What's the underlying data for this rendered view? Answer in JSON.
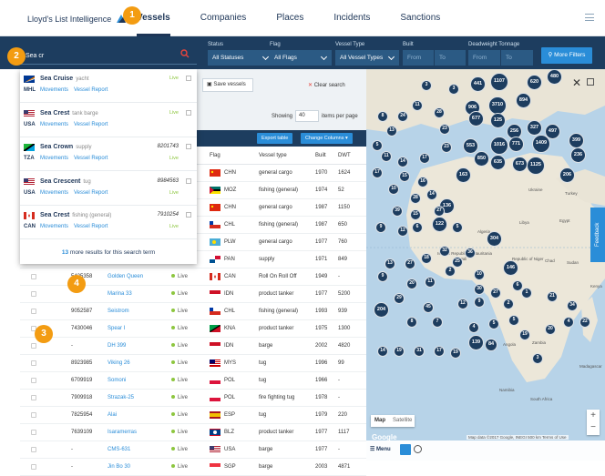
{
  "brand": {
    "name": "Lloyd's List Intelligence"
  },
  "nav": {
    "tabs": [
      "Vessels",
      "Companies",
      "Places",
      "Incidents",
      "Sanctions"
    ],
    "active": "Vessels"
  },
  "search": {
    "value": "Sea cr"
  },
  "filters": [
    {
      "label": "Status",
      "value": "All Statuses"
    },
    {
      "label": "Flag",
      "value": "All Flags"
    },
    {
      "label": "Vessel Type",
      "value": "All Vessel Types"
    },
    {
      "label": "Built",
      "from": "From",
      "to": "To"
    },
    {
      "label": "Deadweight Tonnage",
      "from": "From",
      "to": "To"
    }
  ],
  "more_filters": "More Filters",
  "dropdown": {
    "items": [
      {
        "name": "Sea Cruise",
        "type": "yacht",
        "code": "MHL",
        "imo": "",
        "live": "Live",
        "flag": "mhl"
      },
      {
        "name": "Sea Crest",
        "type": "tank barge",
        "code": "USA",
        "imo": "",
        "live": "Live",
        "flag": "usa"
      },
      {
        "name": "Sea Crown",
        "type": "supply",
        "code": "TZA",
        "imo": "8201743",
        "live": "Live",
        "flag": "tza"
      },
      {
        "name": "Sea Crescent",
        "type": "tug",
        "code": "USA",
        "imo": "8984563",
        "live": "Live",
        "flag": "usa"
      },
      {
        "name": "Sea Crest",
        "type": "fishing (general)",
        "code": "CAN",
        "imo": "7910254",
        "live": "Live",
        "flag": "can"
      }
    ],
    "link_movements": "Movements",
    "link_report": "Vessel Report",
    "more_count": "13",
    "more_text": " more results for this search term"
  },
  "toolbar": {
    "save": "Save vessels",
    "clear": "Clear search",
    "showing": "Showing",
    "per_page_value": "40",
    "per_page": "items per page",
    "export": "Export table",
    "columns": "Change Columns"
  },
  "table": {
    "headers": [
      "Flag",
      "Vessel type",
      "Built",
      "DWT"
    ],
    "rows": [
      {
        "imo": "",
        "name": "",
        "status": "",
        "flag": "chn",
        "code": "CHN",
        "type": "general cargo",
        "built": "1970",
        "dwt": "1624"
      },
      {
        "imo": "",
        "name": "",
        "status": "",
        "flag": "moz",
        "code": "MOZ",
        "type": "fishing (general)",
        "built": "1974",
        "dwt": "52"
      },
      {
        "imo": "",
        "name": "",
        "status": "",
        "flag": "chn",
        "code": "CHN",
        "type": "general cargo",
        "built": "1987",
        "dwt": "1150"
      },
      {
        "imo": "",
        "name": "",
        "status": "",
        "flag": "chl",
        "code": "CHL",
        "type": "fishing (general)",
        "built": "1987",
        "dwt": "650"
      },
      {
        "imo": "",
        "name": "",
        "status": "",
        "flag": "plw",
        "code": "PLW",
        "type": "general cargo",
        "built": "1977",
        "dwt": "760"
      },
      {
        "imo": "",
        "name": "",
        "status": "",
        "flag": "pan",
        "code": "PAN",
        "type": "supply",
        "built": "1971",
        "dwt": "849"
      },
      {
        "imo": "5425358",
        "name": "Golden Queen",
        "status": "Live",
        "flag": "can",
        "code": "CAN",
        "type": "Roll On Roll Off",
        "built": "1949",
        "dwt": "-"
      },
      {
        "imo": "",
        "name": "Marina 33",
        "status": "Live",
        "flag": "idn",
        "code": "IDN",
        "type": "product tanker",
        "built": "1977",
        "dwt": "5200"
      },
      {
        "imo": "9052587",
        "name": "Seistrom",
        "status": "Live",
        "flag": "chl",
        "code": "CHL",
        "type": "fishing (general)",
        "built": "1993",
        "dwt": "939"
      },
      {
        "imo": "7430046",
        "name": "Spear I",
        "status": "Live",
        "flag": "kna",
        "code": "KNA",
        "type": "product tanker",
        "built": "1975",
        "dwt": "1300"
      },
      {
        "imo": "-",
        "name": "DH 399",
        "status": "Live",
        "flag": "idn",
        "code": "IDN",
        "type": "barge",
        "built": "2002",
        "dwt": "4820"
      },
      {
        "imo": "8923985",
        "name": "Viking 26",
        "status": "Live",
        "flag": "mys",
        "code": "MYS",
        "type": "tug",
        "built": "1996",
        "dwt": "99"
      },
      {
        "imo": "6709919",
        "name": "Somoni",
        "status": "Live",
        "flag": "pol",
        "code": "POL",
        "type": "tug",
        "built": "1966",
        "dwt": "-"
      },
      {
        "imo": "7909918",
        "name": "Strazak-25",
        "status": "Live",
        "flag": "pol",
        "code": "POL",
        "type": "fire fighting tug",
        "built": "1978",
        "dwt": "-"
      },
      {
        "imo": "7825954",
        "name": "Alai",
        "status": "Live",
        "flag": "esp",
        "code": "ESP",
        "type": "tug",
        "built": "1979",
        "dwt": "220"
      },
      {
        "imo": "7639109",
        "name": "Isaramerras",
        "status": "Live",
        "flag": "blz",
        "code": "BLZ",
        "type": "product tanker",
        "built": "1977",
        "dwt": "1117"
      },
      {
        "imo": "-",
        "name": "CMS-631",
        "status": "Live",
        "flag": "usa",
        "code": "USA",
        "type": "barge",
        "built": "1977",
        "dwt": "-"
      },
      {
        "imo": "-",
        "name": "Jin Bo 30",
        "status": "Live",
        "flag": "sgp",
        "code": "SGP",
        "type": "barge",
        "built": "2003",
        "dwt": "4871"
      }
    ]
  },
  "map": {
    "labels": [
      "Ukraine",
      "Turkey",
      "Libya",
      "Egypt",
      "Algeria",
      "Chad",
      "Sudan",
      "Mali",
      "Republic of Niger",
      "Kenya",
      "Angola",
      "Zambia",
      "Namibia",
      "South Africa",
      "Madagascar",
      "Saudi Arabia",
      "Islamic Republic of Mauritania"
    ],
    "clusters": [
      "441",
      "1107",
      "620",
      "480",
      "906",
      "3710",
      "894",
      "677",
      "125",
      "256",
      "327",
      "497",
      "1016",
      "771",
      "1409",
      "399",
      "553",
      "850",
      "635",
      "673",
      "1125",
      "236",
      "163",
      "206",
      "136",
      "122",
      "304",
      "146",
      "204",
      "139",
      "84"
    ],
    "small_clusters": [
      "3",
      "3",
      "8",
      "24",
      "11",
      "28",
      "13",
      "5",
      "23",
      "23",
      "11",
      "14",
      "17",
      "17",
      "15",
      "10",
      "16",
      "28",
      "14",
      "39",
      "15",
      "27",
      "12",
      "9",
      "6",
      "5",
      "32",
      "25",
      "36",
      "2",
      "18",
      "27",
      "13",
      "9",
      "20",
      "11",
      "29",
      "10",
      "30",
      "27",
      "6",
      "12",
      "45",
      "9",
      "2",
      "1",
      "21",
      "34",
      "8",
      "7",
      "4",
      "5",
      "5",
      "19",
      "20",
      "4",
      "22",
      "14",
      "19",
      "31",
      "17",
      "19",
      "3"
    ],
    "map_btn": "Map",
    "satellite_btn": "Satellite",
    "google": "Google",
    "attribution": "Map data ©2017 Google, INEGI  500 km  Terms of Use",
    "menu": "Menu",
    "feedback": "Feedback"
  },
  "badges": [
    "1",
    "2",
    "3",
    "4"
  ],
  "colors": {
    "navy": "#1d3d5f",
    "accent": "#2a8dd8",
    "live": "#8dc63f",
    "badge": "#f39c12",
    "search_icon": "#e8453c"
  }
}
